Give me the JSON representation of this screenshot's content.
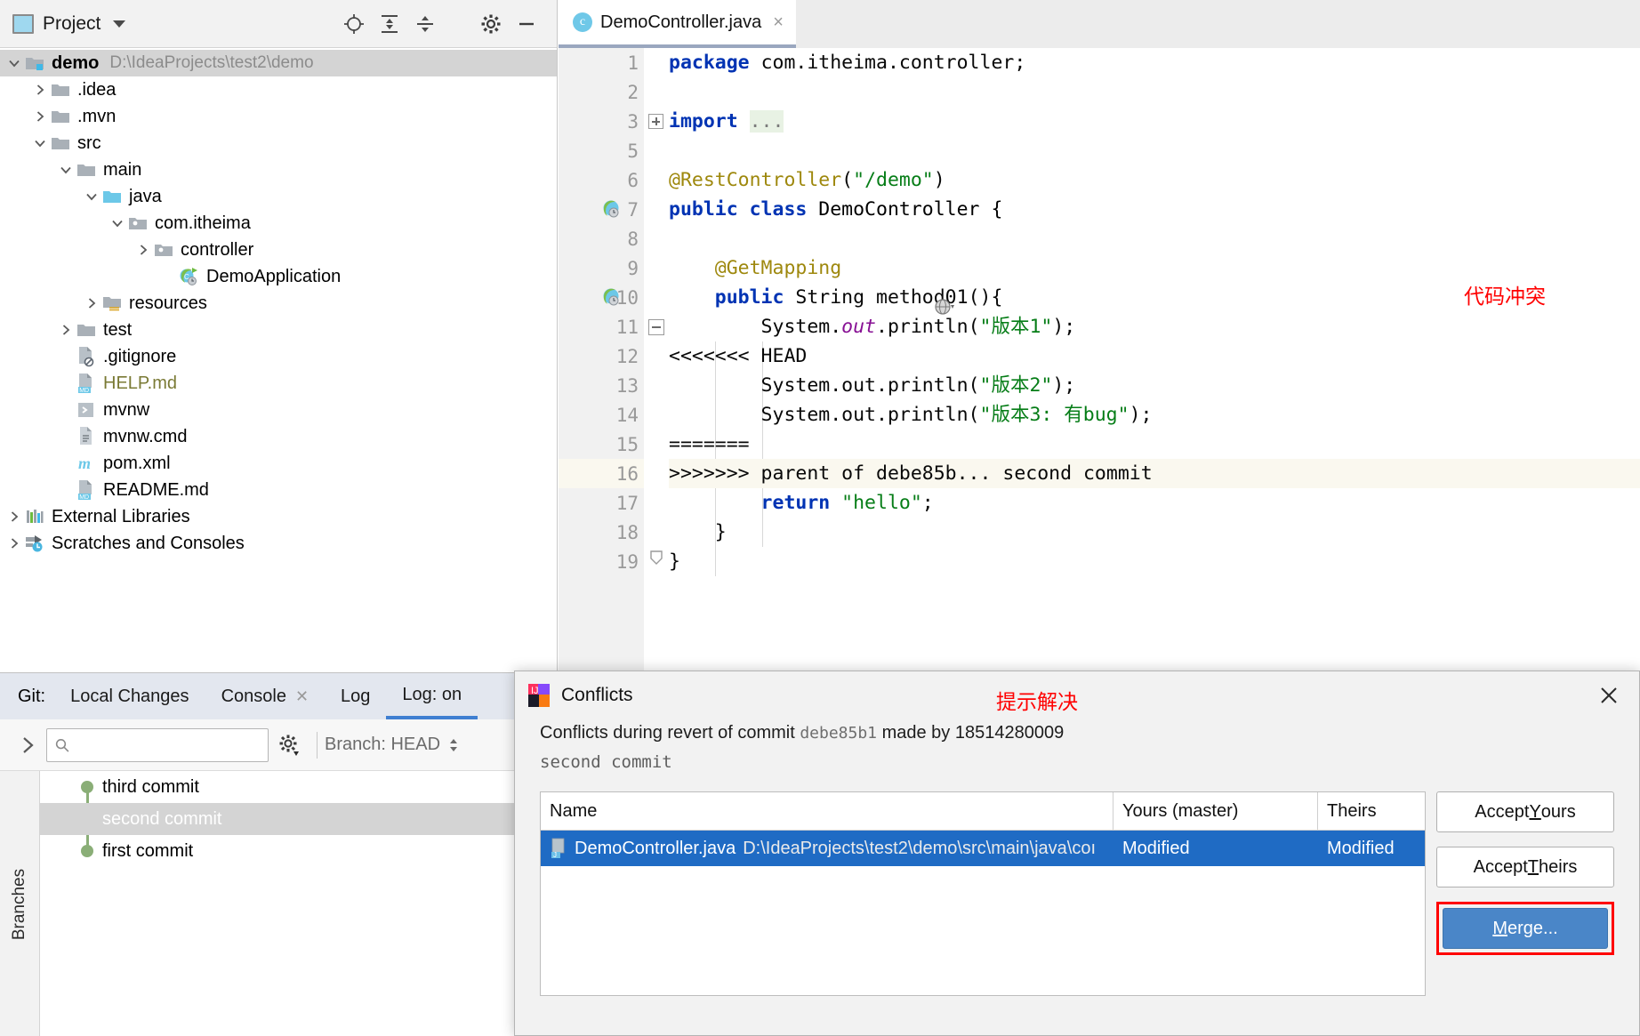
{
  "project_panel": {
    "title": "Project",
    "icons": [
      "locate-icon",
      "expand-all-icon",
      "collapse-all-icon",
      "settings-icon",
      "minimize-icon"
    ],
    "tree": [
      {
        "indent": 0,
        "chev": "down",
        "icon": "module-folder-icon",
        "label": "demo",
        "bold": true,
        "path": "D:\\IdeaProjects\\test2\\demo",
        "selected": true
      },
      {
        "indent": 1,
        "chev": "right",
        "icon": "folder-icon",
        "label": ".idea",
        "bold": false,
        "path": "",
        "selected": false
      },
      {
        "indent": 1,
        "chev": "right",
        "icon": "folder-icon",
        "label": ".mvn",
        "bold": false,
        "path": "",
        "selected": false
      },
      {
        "indent": 1,
        "chev": "down",
        "icon": "folder-icon",
        "label": "src",
        "bold": false,
        "path": "",
        "selected": false
      },
      {
        "indent": 2,
        "chev": "down",
        "icon": "folder-icon",
        "label": "main",
        "bold": false,
        "path": "",
        "selected": false
      },
      {
        "indent": 3,
        "chev": "down",
        "icon": "source-folder-icon",
        "label": "java",
        "bold": false,
        "path": "",
        "selected": false
      },
      {
        "indent": 4,
        "chev": "down",
        "icon": "package-icon",
        "label": "com.itheima",
        "bold": false,
        "path": "",
        "selected": false
      },
      {
        "indent": 5,
        "chev": "right",
        "icon": "package-icon",
        "label": "controller",
        "bold": false,
        "path": "",
        "selected": false
      },
      {
        "indent": 6,
        "chev": "none",
        "icon": "spring-class-icon",
        "label": "DemoApplication",
        "bold": false,
        "path": "",
        "selected": false
      },
      {
        "indent": 3,
        "chev": "right",
        "icon": "resources-folder-icon",
        "label": "resources",
        "bold": false,
        "path": "",
        "selected": false
      },
      {
        "indent": 2,
        "chev": "right",
        "icon": "folder-icon",
        "label": "test",
        "bold": false,
        "path": "",
        "selected": false
      },
      {
        "indent": 2,
        "chev": "none",
        "icon": "gitignore-file-icon",
        "label": ".gitignore",
        "bold": false,
        "path": "",
        "selected": false
      },
      {
        "indent": 2,
        "chev": "none",
        "icon": "markdown-file-icon",
        "label": "HELP.md",
        "bold": false,
        "olive": true,
        "path": "",
        "selected": false
      },
      {
        "indent": 2,
        "chev": "none",
        "icon": "shell-script-icon",
        "label": "mvnw",
        "bold": false,
        "path": "",
        "selected": false
      },
      {
        "indent": 2,
        "chev": "none",
        "icon": "text-file-icon",
        "label": "mvnw.cmd",
        "bold": false,
        "path": "",
        "selected": false
      },
      {
        "indent": 2,
        "chev": "none",
        "icon": "maven-file-icon",
        "label": "pom.xml",
        "bold": false,
        "path": "",
        "selected": false
      },
      {
        "indent": 2,
        "chev": "none",
        "icon": "markdown-file-icon",
        "label": "README.md",
        "bold": false,
        "path": "",
        "selected": false
      },
      {
        "indent": 0,
        "chev": "right",
        "icon": "libraries-icon",
        "label": "External Libraries",
        "bold": false,
        "path": "",
        "selected": false
      },
      {
        "indent": 0,
        "chev": "right",
        "icon": "scratches-icon",
        "label": "Scratches and Consoles",
        "bold": false,
        "path": "",
        "selected": false
      }
    ]
  },
  "editor": {
    "tab": {
      "label": "DemoController.java",
      "icon": "java-class-icon",
      "close": "×"
    },
    "annotation": "代码冲突",
    "line_numbers": [
      "1",
      "2",
      "3",
      "5",
      "6",
      "7",
      "8",
      "9",
      "10",
      "11",
      "12",
      "13",
      "14",
      "15",
      "16",
      "17",
      "18",
      "19"
    ]
  },
  "git": {
    "label": "Git:",
    "tabs": [
      {
        "label": "Local Changes",
        "closable": false,
        "active": false
      },
      {
        "label": "Console",
        "closable": true,
        "active": false
      },
      {
        "label": "Log",
        "closable": false,
        "active": false
      },
      {
        "label": "Log: on",
        "closable": false,
        "active": true
      }
    ],
    "search_placeholder": "",
    "search_value": "",
    "branch_filter": "Branch: HEAD",
    "rail_label": "Branches",
    "commits": [
      {
        "message": "third commit",
        "selected": false
      },
      {
        "message": "second commit",
        "selected": true
      },
      {
        "message": "first commit",
        "selected": false
      }
    ]
  },
  "dialog": {
    "title": "Conflicts",
    "annotation": "提示解决",
    "description_prefix": "Conflicts during revert of commit ",
    "commit_hash": "debe85b1",
    "description_mid": " made by ",
    "author": "18514280009",
    "commit_message": "second commit",
    "table": {
      "columns": [
        "Name",
        "Yours (master)",
        "Theirs"
      ],
      "rows": [
        {
          "file": "DemoController.java",
          "path": "D:\\IdeaProjects\\test2\\demo\\src\\main\\java\\coı",
          "yours": "Modified",
          "theirs": "Modified",
          "selected": true
        }
      ]
    },
    "buttons": [
      {
        "label_before": "Accept ",
        "mnemonic": "Y",
        "label_after": "ours",
        "name": "accept-yours-button",
        "primary": false,
        "highlighted": false
      },
      {
        "label_before": "Accept ",
        "mnemonic": "T",
        "label_after": "heirs",
        "name": "accept-theirs-button",
        "primary": false,
        "highlighted": false
      },
      {
        "label_before": "",
        "mnemonic": "M",
        "label_after": "erge...",
        "name": "merge-button",
        "primary": true,
        "highlighted": true
      }
    ],
    "close_label": "✕"
  },
  "code": {
    "lines": [
      [
        {
          "t": "package ",
          "c": "kw"
        },
        {
          "t": "com.itheima.controller;",
          "c": "plain"
        }
      ],
      [],
      [
        {
          "t": "import ",
          "c": "kw"
        },
        {
          "t": "...",
          "c": "fld"
        }
      ],
      [],
      [
        {
          "t": "@RestController",
          "c": "ann"
        },
        {
          "t": "(",
          "c": "plain"
        },
        {
          "t": "\"/demo\"",
          "c": "str"
        },
        {
          "t": ")",
          "c": "plain"
        }
      ],
      [
        {
          "t": "public class ",
          "c": "kw"
        },
        {
          "t": "DemoController {",
          "c": "cls"
        }
      ],
      [],
      [
        {
          "t": "    @GetMapping",
          "c": "ann"
        }
      ],
      [
        {
          "t": "    public ",
          "c": "kw"
        },
        {
          "t": "String ",
          "c": "plain"
        },
        {
          "t": "method01",
          "c": "plain"
        },
        {
          "t": "(){",
          "c": "plain"
        }
      ],
      [
        {
          "t": "        System.",
          "c": "plain"
        },
        {
          "t": "out",
          "c": "stat"
        },
        {
          "t": ".println(",
          "c": "plain"
        },
        {
          "t": "\"版本1\"",
          "c": "str"
        },
        {
          "t": ");",
          "c": "plain"
        }
      ],
      [
        {
          "t": "<<<<<<< HEAD",
          "c": "plain"
        }
      ],
      [
        {
          "t": "        System.out.println(",
          "c": "plain"
        },
        {
          "t": "\"版本2\"",
          "c": "str"
        },
        {
          "t": ");",
          "c": "plain"
        }
      ],
      [
        {
          "t": "        System.out.println(",
          "c": "plain"
        },
        {
          "t": "\"版本3: 有bug\"",
          "c": "str"
        },
        {
          "t": ");",
          "c": "plain"
        }
      ],
      [
        {
          "t": "=======",
          "c": "plain"
        }
      ],
      [
        {
          "t": ">>>>>>> parent of debe85b... second commit",
          "c": "plain"
        }
      ],
      [
        {
          "t": "        return ",
          "c": "kw"
        },
        {
          "t": "\"hello\"",
          "c": "str"
        },
        {
          "t": ";",
          "c": "plain"
        }
      ],
      [
        {
          "t": "    }",
          "c": "plain"
        }
      ],
      [
        {
          "t": "}",
          "c": "plain"
        }
      ]
    ]
  }
}
